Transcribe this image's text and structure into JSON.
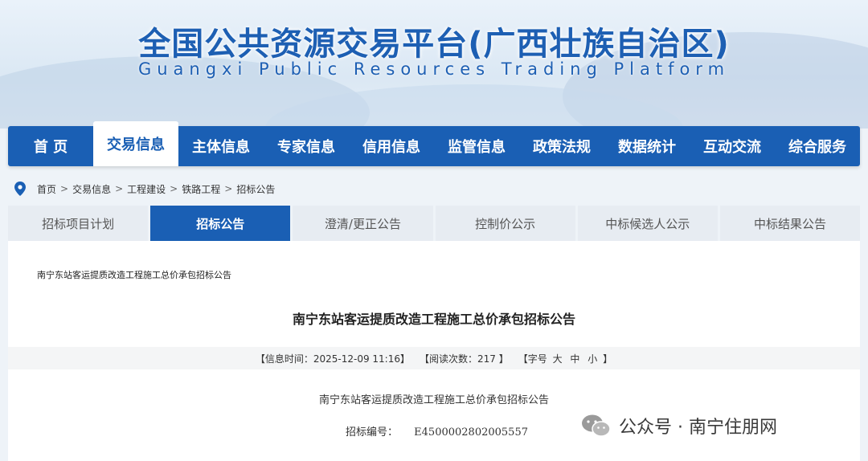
{
  "header": {
    "title": "全国公共资源交易平台(广西壮族自治区)",
    "subtitle": "Guangxi Public Resources Trading Platform"
  },
  "nav": {
    "items": [
      {
        "label": "首 页"
      },
      {
        "label": "交易信息"
      },
      {
        "label": "主体信息"
      },
      {
        "label": "专家信息"
      },
      {
        "label": "信用信息"
      },
      {
        "label": "监管信息"
      },
      {
        "label": "政策法规"
      },
      {
        "label": "数据统计"
      },
      {
        "label": "互动交流"
      },
      {
        "label": "综合服务"
      }
    ],
    "active_index": 1
  },
  "breadcrumb": {
    "icon": "location-pin-icon",
    "items": [
      "首页",
      "交易信息",
      "工程建设",
      "铁路工程",
      "招标公告"
    ],
    "separator": ">"
  },
  "subtabs": {
    "items": [
      "招标项目计划",
      "招标公告",
      "澄清/更正公告",
      "控制价公示",
      "中标候选人公示",
      "中标结果公告"
    ],
    "active_index": 1
  },
  "article": {
    "crumb_title": "南宁东站客运提质改造工程施工总价承包招标公告",
    "title": "南宁东站客运提质改造工程施工总价承包招标公告",
    "meta": {
      "publish_time": "【信息时间：2025-12-09 11:16】",
      "views": "【阅读次数：217 】",
      "font_size_open": "【字号",
      "font_large": "大",
      "font_medium": "中",
      "font_small": "小",
      "font_size_close": "】"
    },
    "body_title": "南宁东站客运提质改造工程施工总价承包招标公告",
    "project_no_label": "招标编号：",
    "project_no_value": "E4500002802005557"
  },
  "watermark": {
    "text": "公众号 · 南宁住朋网",
    "icon": "wechat-icon"
  },
  "colors": {
    "primary": "#1a5fb4",
    "tab_inactive": "#e7ecf2"
  }
}
